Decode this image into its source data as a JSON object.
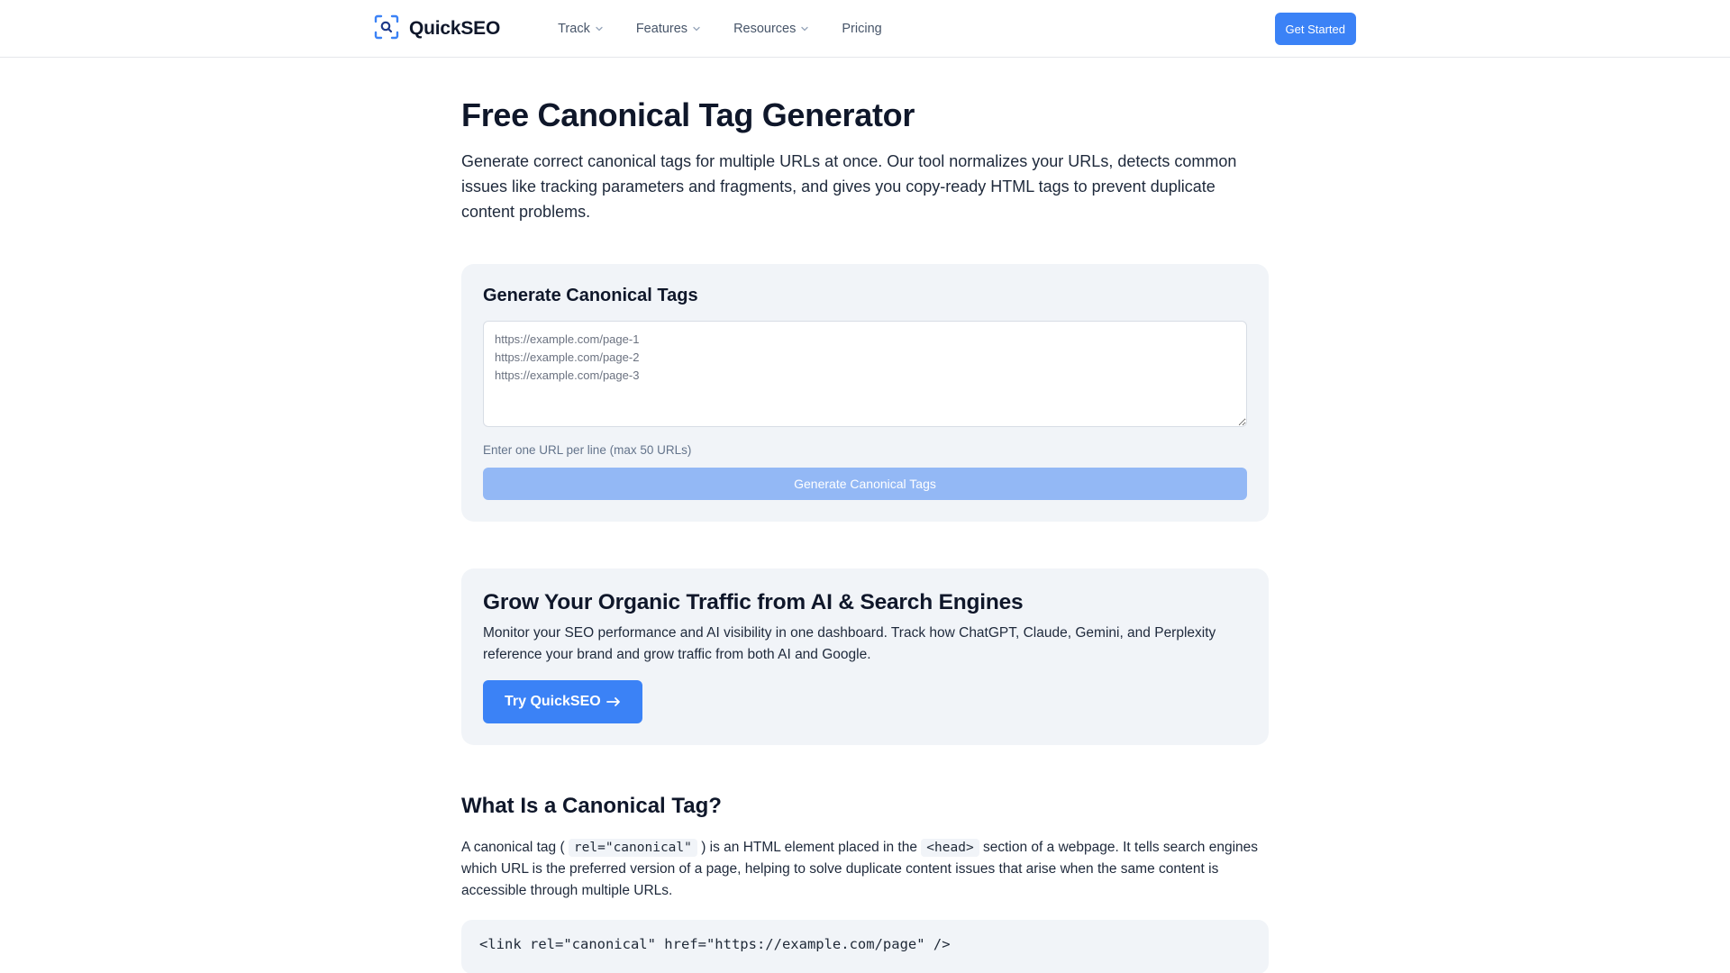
{
  "brand": {
    "name": "QuickSEO",
    "accent": "#3b82f6"
  },
  "nav": {
    "items": [
      {
        "label": "Track",
        "has_dropdown": true
      },
      {
        "label": "Features",
        "has_dropdown": true
      },
      {
        "label": "Resources",
        "has_dropdown": true
      },
      {
        "label": "Pricing",
        "has_dropdown": false
      }
    ],
    "cta_label": "Get Started"
  },
  "hero": {
    "title": "Free Canonical Tag Generator",
    "description": "Generate correct canonical tags for multiple URLs at once. Our tool normalizes your URLs, detects common issues like tracking parameters and fragments, and gives you copy-ready HTML tags to prevent duplicate content problems."
  },
  "generator": {
    "title": "Generate Canonical Tags",
    "placeholder": "https://example.com/page-1\nhttps://example.com/page-2\nhttps://example.com/page-3",
    "value": "",
    "hint": "Enter one URL per line (max 50 URLs)",
    "button_label": "Generate Canonical Tags",
    "button_disabled": true
  },
  "cta": {
    "title": "Grow Your Organic Traffic from AI & Search Engines",
    "text": "Monitor your SEO performance and AI visibility in one dashboard. Track how ChatGPT, Claude, Gemini, and Perplexity reference your brand and grow traffic from both AI and Google.",
    "button_label": "Try QuickSEO",
    "button_icon": "arrow-right-icon"
  },
  "what_is": {
    "title": "What Is a Canonical Tag?",
    "text_1": "A canonical tag (",
    "code_1": "rel=\"canonical\"",
    "text_2": ") is an HTML element placed in the",
    "code_2": "<head>",
    "text_3": "section of a webpage. It tells search engines which URL is the preferred version of a page, helping to solve duplicate content issues that arise when the same content is accessible through multiple URLs.",
    "code_example": "<link rel=\"canonical\" href=\"https://example.com/page\" />"
  }
}
